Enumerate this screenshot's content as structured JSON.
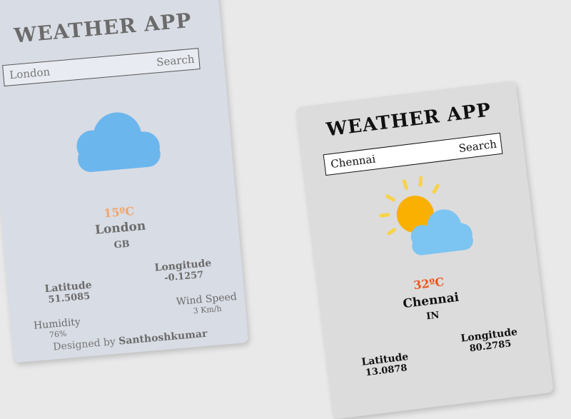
{
  "cards": [
    {
      "title": "WEATHER APP",
      "search": {
        "value": "London",
        "button": "Search"
      },
      "weather_icon": "cloud-icon",
      "temperature": "15ºC",
      "city": "London",
      "country": "GB",
      "latitude": {
        "label": "Latitude",
        "value": "51.5085"
      },
      "longitude": {
        "label": "Longitude",
        "value": "-0.1257"
      },
      "humidity": {
        "label": "Humidity",
        "value": "76%"
      },
      "wind": {
        "label": "Wind Speed",
        "value": "3 Km/h"
      },
      "footer": {
        "prefix": "Designed by ",
        "author": "Santhoshkumar"
      }
    },
    {
      "title": "WEATHER APP",
      "search": {
        "value": "Chennai",
        "button": "Search"
      },
      "weather_icon": "sun-behind-cloud-icon",
      "temperature": "32ºC",
      "city": "Chennai",
      "country": "IN",
      "latitude": {
        "label": "Latitude",
        "value": "13.0878"
      },
      "longitude": {
        "label": "Longitude",
        "value": "80.2785"
      }
    }
  ],
  "colors": {
    "cloud_blue": "#6cb6ee",
    "sun_orange": "#f9b000",
    "sun_ray": "#f7d34a",
    "temp_london": "#f2a46a",
    "temp_chennai": "#f0561e"
  }
}
